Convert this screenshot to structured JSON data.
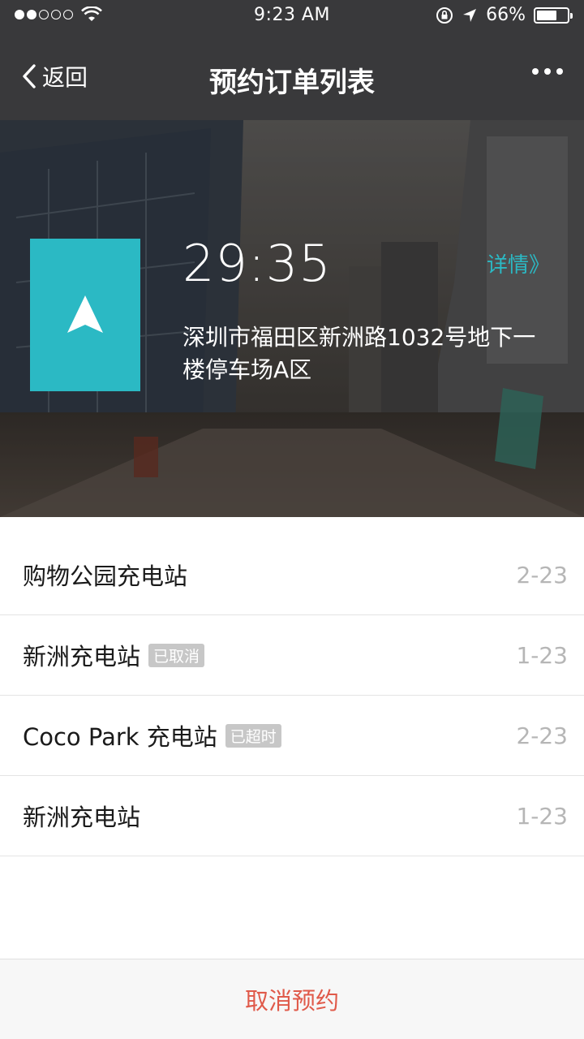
{
  "status_bar": {
    "time": "9:23 AM",
    "battery_percent": "66%",
    "battery_level": 0.66,
    "signal_dots_filled": 2,
    "signal_dots_total": 5
  },
  "nav": {
    "back_label": "返回",
    "title": "预约订单列表"
  },
  "hero": {
    "timer": "29:35",
    "detail_link": "详情》",
    "address": "深圳市福田区新洲路1032号地下一楼停车场A区"
  },
  "orders": [
    {
      "name": "购物公园充电站",
      "tag": "",
      "date": "2-23"
    },
    {
      "name": "新洲充电站",
      "tag": "已取消",
      "date": "1-23"
    },
    {
      "name": "Coco Park 充电站",
      "tag": "已超时",
      "date": "2-23"
    },
    {
      "name": "新洲充电站",
      "tag": "",
      "date": "1-23"
    }
  ],
  "bottom": {
    "cancel_label": "取消预约"
  },
  "colors": {
    "accent": "#2bb9c4",
    "nav_bg": "#39393b",
    "danger_text": "#e05a4a",
    "tag_bg": "#c7c7c7",
    "date_text": "#b6b6b6"
  }
}
